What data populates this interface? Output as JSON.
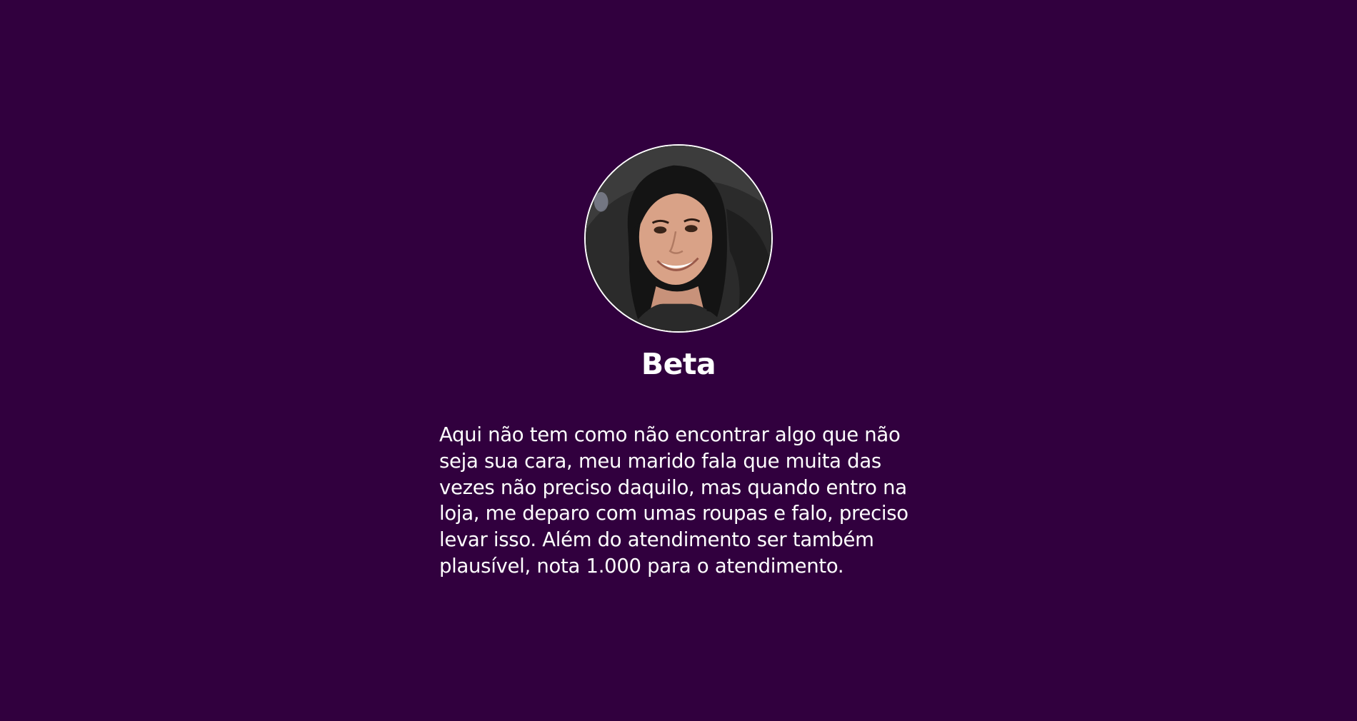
{
  "page": {
    "background_color": "#31003e"
  },
  "testimonial": {
    "avatar_icon": "person-photo",
    "name": "Beta",
    "quote": "Aqui não tem como não encontrar algo que não seja sua cara, meu marido fala que muita das vezes não preciso daquilo, mas quando entro na loja, me deparo com umas roupas e falo, preciso levar isso. Além do atendimento ser também plausível, nota 1.000 para o atendimento."
  }
}
